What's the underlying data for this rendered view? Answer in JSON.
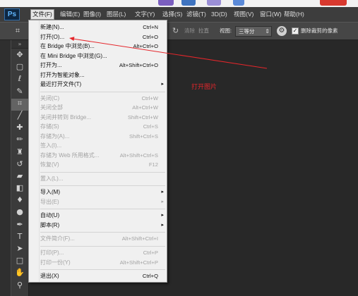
{
  "top_strip": {
    "icon_colors": [
      "#7b5fbf",
      "#3f74c0",
      "#9b8fd6",
      "#5b8ad8",
      "#d8392f"
    ]
  },
  "app": {
    "logo": "Ps"
  },
  "menubar": {
    "active_index": 0,
    "items": [
      {
        "label": "文件(F)"
      },
      {
        "label": "编辑(E)"
      },
      {
        "label": "图像(I)"
      },
      {
        "label": "图层(L)"
      },
      {
        "label": "文字(Y)"
      },
      {
        "label": "选择(S)"
      },
      {
        "label": "滤镜(T)"
      },
      {
        "label": "3D(D)"
      },
      {
        "label": "视图(V)"
      },
      {
        "label": "窗口(W)"
      },
      {
        "label": "帮助(H)"
      }
    ]
  },
  "options_bar": {
    "preset_icon": "crop-preset-icon",
    "reset_icon": "rotate-icon",
    "clear_label": "清除",
    "straighten_label": "拉直",
    "view_label": "视图:",
    "view_value": "三等分",
    "view_arrows_icon": "updown-arrows-icon",
    "gear_icon": "gear-icon",
    "delete_pixels_checked": true,
    "delete_pixels_label": "删除裁剪的像素"
  },
  "toolbar": {
    "collapse_icon": "collapse-icon",
    "tools": [
      {
        "icon": "move-tool-icon"
      },
      {
        "icon": "marquee-tool-icon"
      },
      {
        "icon": "lasso-tool-icon"
      },
      {
        "icon": "quick-selection-tool-icon"
      },
      {
        "icon": "crop-tool-icon",
        "selected": true
      },
      {
        "icon": "eyedropper-tool-icon"
      },
      {
        "icon": "spot-healing-brush-icon"
      },
      {
        "icon": "brush-tool-icon"
      },
      {
        "icon": "clone-stamp-tool-icon"
      },
      {
        "icon": "history-brush-tool-icon"
      },
      {
        "icon": "eraser-tool-icon"
      },
      {
        "icon": "gradient-tool-icon"
      },
      {
        "icon": "blur-tool-icon"
      },
      {
        "icon": "dodge-tool-icon"
      },
      {
        "icon": "pen-tool-icon"
      },
      {
        "icon": "type-tool-icon"
      },
      {
        "icon": "path-selection-tool-icon"
      },
      {
        "icon": "rectangle-tool-icon"
      },
      {
        "icon": "hand-tool-icon"
      },
      {
        "icon": "zoom-tool-icon"
      }
    ]
  },
  "file_menu": {
    "items": [
      {
        "label": "新建(N)...",
        "shortcut": "Ctrl+N"
      },
      {
        "label": "打开(O)...",
        "shortcut": "Ctrl+O"
      },
      {
        "label": "在 Bridge 中浏览(B)...",
        "shortcut": "Alt+Ctrl+O"
      },
      {
        "label": "在 Mini Bridge 中浏览(G)..."
      },
      {
        "label": "打开为...",
        "shortcut": "Alt+Shift+Ctrl+O"
      },
      {
        "label": "打开为智能对象..."
      },
      {
        "label": "最近打开文件(T)",
        "submenu": true
      },
      {
        "separator": true
      },
      {
        "label": "关闭(C)",
        "shortcut": "Ctrl+W",
        "disabled": true
      },
      {
        "label": "关闭全部",
        "shortcut": "Alt+Ctrl+W",
        "disabled": true
      },
      {
        "label": "关闭并转到 Bridge...",
        "shortcut": "Shift+Ctrl+W",
        "disabled": true
      },
      {
        "label": "存储(S)",
        "shortcut": "Ctrl+S",
        "disabled": true
      },
      {
        "label": "存储为(A)...",
        "shortcut": "Shift+Ctrl+S",
        "disabled": true
      },
      {
        "label": "签入(I)...",
        "disabled": true
      },
      {
        "label": "存储为 Web 所用格式...",
        "shortcut": "Alt+Shift+Ctrl+S",
        "disabled": true
      },
      {
        "label": "恢复(V)",
        "shortcut": "F12",
        "disabled": true
      },
      {
        "separator": true
      },
      {
        "label": "置入(L)...",
        "disabled": true
      },
      {
        "separator": true
      },
      {
        "label": "导入(M)",
        "submenu": true
      },
      {
        "label": "导出(E)",
        "submenu": true,
        "disabled": true
      },
      {
        "separator": true
      },
      {
        "label": "自动(U)",
        "submenu": true
      },
      {
        "label": "脚本(R)",
        "submenu": true
      },
      {
        "separator": true
      },
      {
        "label": "文件简介(F)...",
        "shortcut": "Alt+Shift+Ctrl+I",
        "disabled": true
      },
      {
        "separator": true
      },
      {
        "label": "打印(P)...",
        "shortcut": "Ctrl+P",
        "disabled": true
      },
      {
        "label": "打印一份(Y)",
        "shortcut": "Alt+Shift+Ctrl+P",
        "disabled": true
      },
      {
        "separator": true
      },
      {
        "label": "退出(X)",
        "shortcut": "Ctrl+Q"
      }
    ]
  },
  "annotation": {
    "text": "打开图片",
    "color": "#e5262b"
  }
}
